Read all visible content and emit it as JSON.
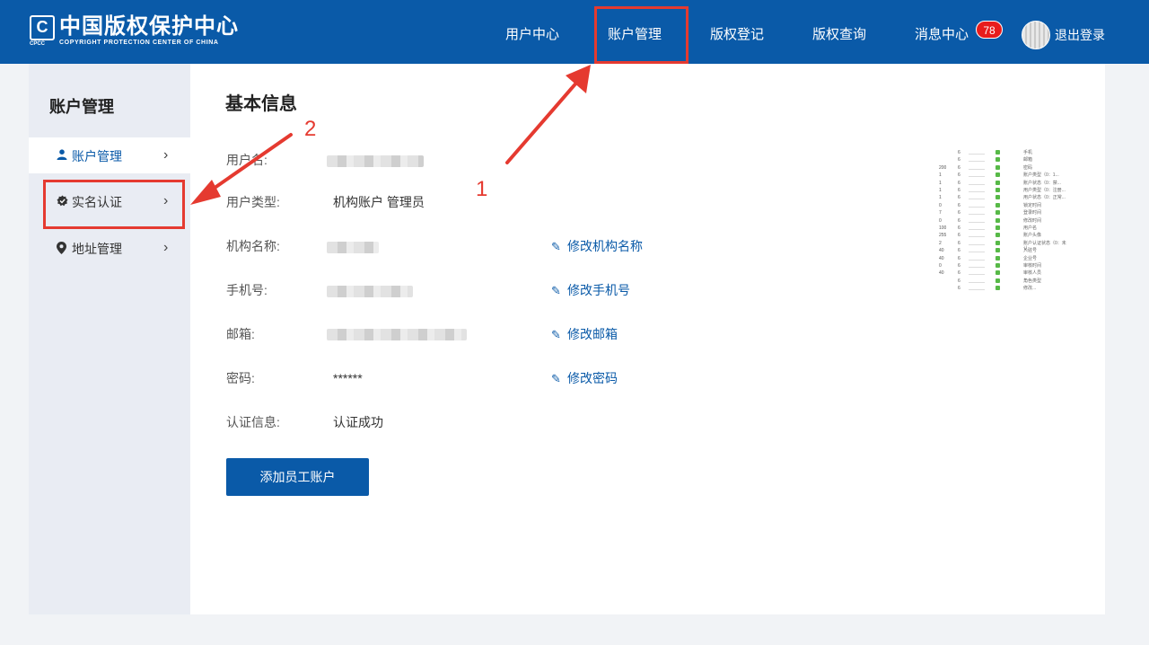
{
  "header": {
    "logo_cn": "中国版权保护中心",
    "logo_en": "COPYRIGHT PROTECTION CENTER OF CHINA",
    "logo_mark": "C",
    "logo_abbr": "CPCC",
    "nav": [
      "用户中心",
      "账户管理",
      "版权登记",
      "版权查询",
      "消息中心"
    ],
    "message_count": "78",
    "logout_label": "退出登录"
  },
  "sidebar": {
    "title": "账户管理",
    "items": [
      {
        "label": "账户管理",
        "icon": "user-icon"
      },
      {
        "label": "实名认证",
        "icon": "verified-badge-icon"
      },
      {
        "label": "地址管理",
        "icon": "location-pin-icon"
      }
    ],
    "chevron": "›"
  },
  "main": {
    "title": "基本信息",
    "rows": [
      {
        "label": "用户名:",
        "value": ""
      },
      {
        "label": "用户类型:",
        "value": "机构账户 管理员"
      },
      {
        "label": "机构名称:",
        "value": "",
        "action": "修改机构名称"
      },
      {
        "label": "手机号:",
        "value": "",
        "action": "修改手机号"
      },
      {
        "label": "邮箱:",
        "value": "",
        "action": "修改邮箱"
      },
      {
        "label": "密码:",
        "value": "******",
        "action": "修改密码"
      },
      {
        "label": "认证信息:",
        "value": "认证成功"
      }
    ],
    "add_button": "添加员工账户"
  },
  "annotations": {
    "step1": "1",
    "step2": "2",
    "color": "#e53a30"
  },
  "thumbnail_table": {
    "rows": [
      [
        "",
        "6",
        "手机"
      ],
      [
        "",
        "6",
        "邮箱"
      ],
      [
        "200",
        "6",
        "密码"
      ],
      [
        "1",
        "6",
        "账户类型（0：1..."
      ],
      [
        "1",
        "6",
        "账户状态（0：禁..."
      ],
      [
        "1",
        "6",
        "用户类型（0：注册..."
      ],
      [
        "1",
        "6",
        "用户状态（0：正常..."
      ],
      [
        "0",
        "6",
        "锁定时间"
      ],
      [
        "7",
        "6",
        "登录时间"
      ],
      [
        "0",
        "6",
        "修改时间"
      ],
      [
        "100",
        "6",
        "用户名"
      ],
      [
        "255",
        "6",
        "账户头像"
      ],
      [
        "2",
        "6",
        "账户认证状态（0：未认..."
      ],
      [
        "40",
        "6",
        "入驻号"
      ],
      [
        "40",
        "6",
        "企业号"
      ],
      [
        "0",
        "6",
        "审核时间"
      ],
      [
        "40",
        "6",
        "审核人员"
      ],
      [
        "",
        "6",
        "角色类型"
      ],
      [
        "",
        "6",
        "修改..."
      ]
    ]
  }
}
